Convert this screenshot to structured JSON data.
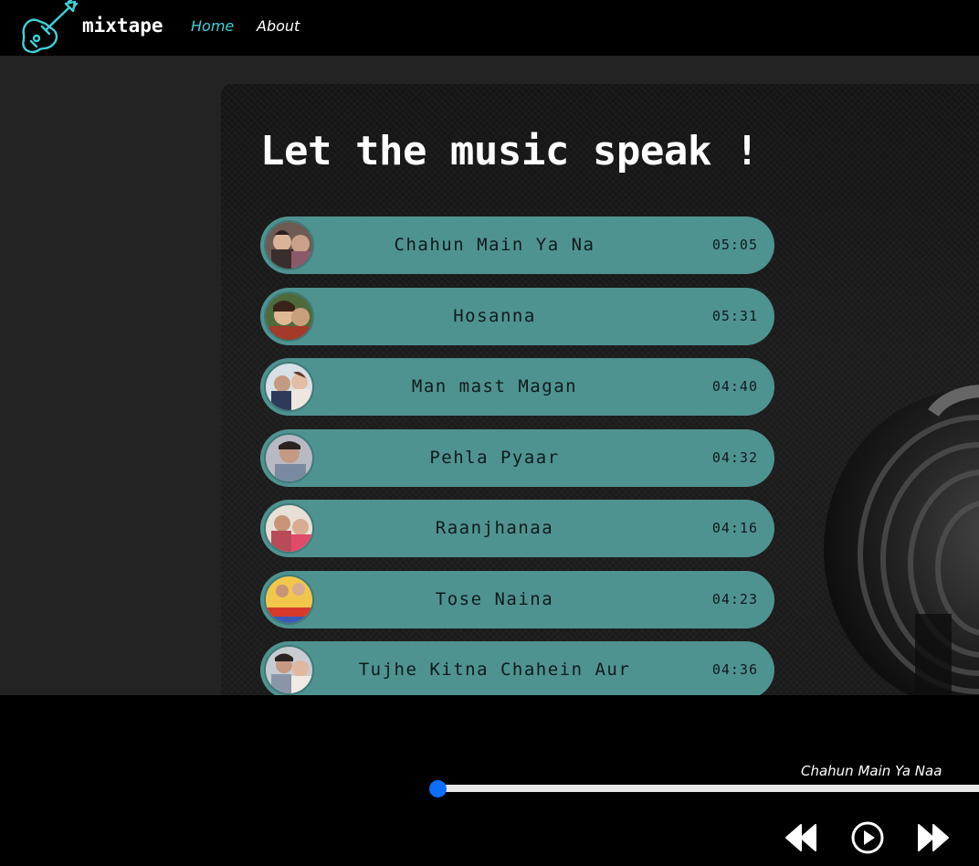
{
  "navbar": {
    "brand": "mixtape",
    "links": [
      {
        "label": "Home",
        "active": true
      },
      {
        "label": "About",
        "active": false
      }
    ],
    "logo_icon": "guitar-icon",
    "accent_color": "#3fd1d6"
  },
  "hero": {
    "title": "Let the music speak !"
  },
  "songs": [
    {
      "name": "Chahun Main Ya Na",
      "duration": "05:05"
    },
    {
      "name": "Hosanna",
      "duration": "05:31"
    },
    {
      "name": "Man mast Magan",
      "duration": "04:40"
    },
    {
      "name": "Pehla Pyaar",
      "duration": "04:32"
    },
    {
      "name": "Raanjhanaa",
      "duration": "04:16"
    },
    {
      "name": "Tose Naina",
      "duration": "04:23"
    },
    {
      "name": "Tujhe Kitna Chahein Aur",
      "duration": "04:36"
    }
  ],
  "player": {
    "now_playing": "Chahun Main Ya Naa",
    "progress": 0,
    "controls": [
      "previous-icon",
      "play-icon",
      "next-icon"
    ],
    "progress_color": "#0d6efd"
  },
  "colors": {
    "song_item_bg": "#4f9391",
    "page_bg": "#232323",
    "navbar_bg": "#000000"
  }
}
